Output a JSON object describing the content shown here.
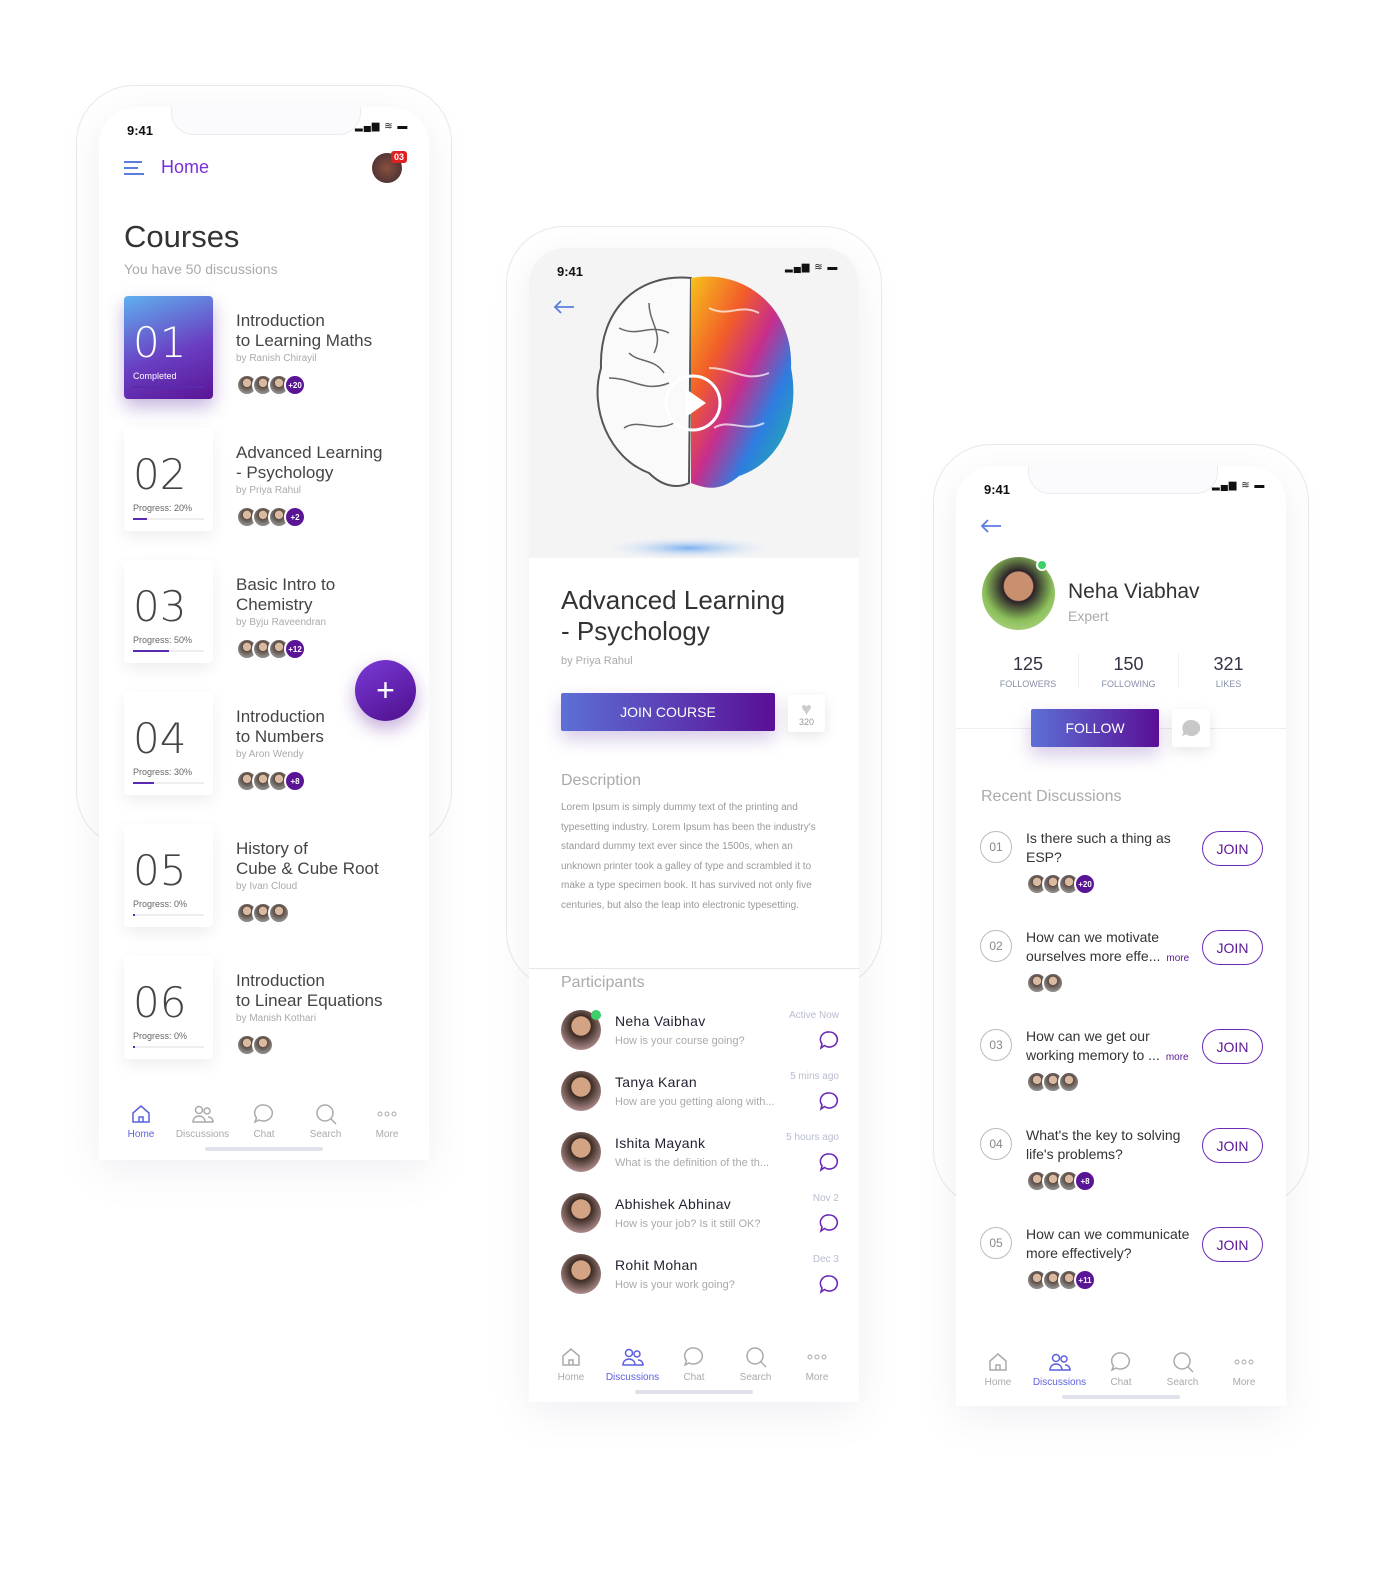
{
  "status": {
    "time": "9:41"
  },
  "screen1": {
    "header": {
      "title": "Home",
      "badge": "03"
    },
    "title": "Courses",
    "subtitle": "You have 50 discussions",
    "courses": [
      {
        "num": "01",
        "title1": "Introduction",
        "title2": "to Learning Maths",
        "author": "by Ranish Chirayil",
        "status": "Completed",
        "progress": 100,
        "avatars": 3,
        "more": "+20"
      },
      {
        "num": "02",
        "title1": "Advanced  Learning",
        "title2": "- Psychology",
        "author": "by Priya Rahul",
        "status": "Progress: 20%",
        "progress": 20,
        "avatars": 3,
        "more": "+2"
      },
      {
        "num": "03",
        "title1": "Basic Intro to",
        "title2": "Chemistry",
        "author": "by Byju Raveendran",
        "status": "Progress: 50%",
        "progress": 50,
        "avatars": 3,
        "more": "+12"
      },
      {
        "num": "04",
        "title1": "Introduction",
        "title2": "to Numbers",
        "author": "by Aron Wendy",
        "status": "Progress: 30%",
        "progress": 30,
        "avatars": 3,
        "more": "+8"
      },
      {
        "num": "05",
        "title1": "History of",
        "title2": "Cube & Cube Root",
        "author": "by Ivan Cloud",
        "status": "Progress: 0%",
        "progress": 0,
        "avatars": 3,
        "more": ""
      },
      {
        "num": "06",
        "title1": "Introduction",
        "title2": "to Linear Equations",
        "author": "by Manish Kothari",
        "status": "Progress: 0%",
        "progress": 0,
        "avatars": 2,
        "more": ""
      }
    ],
    "fab": "+",
    "nav": [
      {
        "label": "Home",
        "icon": "home-icon",
        "active": true
      },
      {
        "label": "Discussions",
        "icon": "users-icon"
      },
      {
        "label": "Chat",
        "icon": "chat-icon"
      },
      {
        "label": "Search",
        "icon": "search-icon"
      },
      {
        "label": "More",
        "icon": "more-icon"
      }
    ]
  },
  "screen2": {
    "title1": "Advanced  Learning",
    "title2": "- Psychology",
    "author": "by Priya Rahul",
    "join_label": "JOIN COURSE",
    "likes": "320",
    "description_heading": "Description",
    "description": "Lorem Ipsum is simply dummy text of the printing and typesetting industry. Lorem Ipsum has been the industry's standard dummy text ever since the 1500s, when an unknown printer took a galley of type and scrambled it to make a type specimen book. It has survived not only five centuries, but also the leap into electronic typesetting.",
    "participants_heading": "Participants",
    "participants": [
      {
        "name": "Neha Vaibhav",
        "message": "How is your course going?",
        "time": "Active Now",
        "online": true
      },
      {
        "name": "Tanya Karan",
        "message": "How are you getting along with...",
        "time": "5 mins ago"
      },
      {
        "name": "Ishita Mayank",
        "message": "What is the definition of the th...",
        "time": "5 hours ago"
      },
      {
        "name": "Abhishek Abhinav",
        "message": "How is your job? Is it still OK?",
        "time": "Nov 2"
      },
      {
        "name": "Rohit Mohan",
        "message": "How is your work going?",
        "time": "Dec 3"
      }
    ],
    "nav": [
      {
        "label": "Home",
        "icon": "home-icon"
      },
      {
        "label": "Discussions",
        "icon": "users-icon",
        "active": true
      },
      {
        "label": "Chat",
        "icon": "chat-icon"
      },
      {
        "label": "Search",
        "icon": "search-icon"
      },
      {
        "label": "More",
        "icon": "more-icon"
      }
    ]
  },
  "screen3": {
    "name": "Neha Viabhav",
    "role": "Expert",
    "stats": [
      {
        "value": "125",
        "label": "FOLLOWERS"
      },
      {
        "value": "150",
        "label": "FOLLOWING"
      },
      {
        "value": "321",
        "label": "LIKES"
      }
    ],
    "follow_label": "FOLLOW",
    "recent_heading": "Recent Discussions",
    "join_label": "JOIN",
    "discussions": [
      {
        "num": "01",
        "text": "Is there such a thing as ESP?",
        "more": "",
        "avatars": 3,
        "extra": "+20"
      },
      {
        "num": "02",
        "text": "How can we motivate ourselves more effe...",
        "more": "more",
        "avatars": 2,
        "extra": ""
      },
      {
        "num": "03",
        "text": "How can we get our working memory to ...",
        "more": "more",
        "avatars": 3,
        "extra": ""
      },
      {
        "num": "04",
        "text": "What's the key to solving life's problems?",
        "more": "",
        "avatars": 3,
        "extra": "+8"
      },
      {
        "num": "05",
        "text": "How can we communicate more effectively?",
        "more": "",
        "avatars": 3,
        "extra": "+11"
      }
    ],
    "nav": [
      {
        "label": "Home",
        "icon": "home-icon"
      },
      {
        "label": "Discussions",
        "icon": "users-icon",
        "active": true
      },
      {
        "label": "Chat",
        "icon": "chat-icon"
      },
      {
        "label": "Search",
        "icon": "search-icon"
      },
      {
        "label": "More",
        "icon": "more-icon"
      }
    ]
  },
  "colors": {
    "accent": "#5a1596",
    "nav_active": "#5b5fe0",
    "badge": "#e02020",
    "online": "#3ccf6a"
  }
}
